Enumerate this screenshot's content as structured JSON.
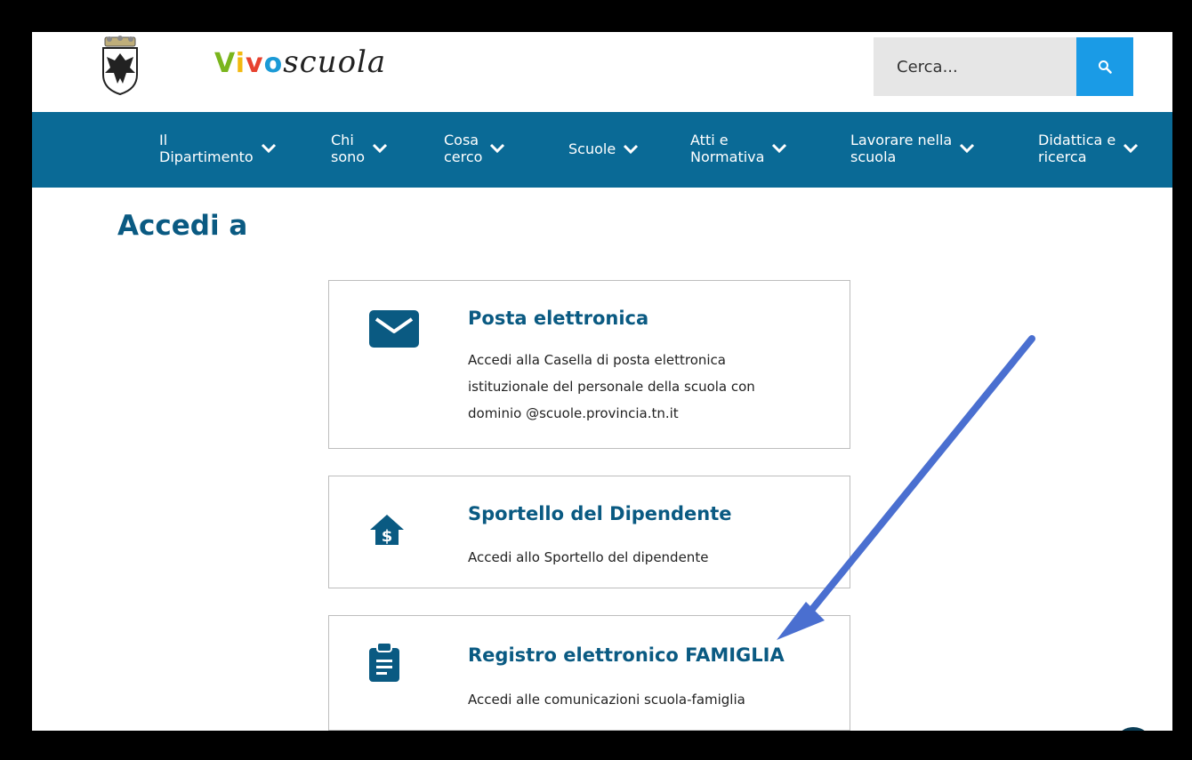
{
  "header": {
    "brand": {
      "v": "V",
      "i": "i",
      "v2": "v",
      "o": "o",
      "rest": "scuola"
    },
    "search_placeholder": "Cerca..."
  },
  "nav": [
    {
      "label": "Il\nDipartimento"
    },
    {
      "label": "Chi\nsono"
    },
    {
      "label": "Cosa\ncerco"
    },
    {
      "label": "Scuole"
    },
    {
      "label": "Atti e\nNormativa"
    },
    {
      "label": "Lavorare nella\nscuola"
    },
    {
      "label": "Didattica e\nricerca"
    }
  ],
  "page": {
    "title": "Accedi a"
  },
  "cards": [
    {
      "title": "Posta elettronica",
      "description": "Accedi alla Casella di posta elettronica istituzionale del personale della scuola con dominio @scuole.provincia.tn.it",
      "icon": "envelope-icon"
    },
    {
      "title": "Sportello del Dipendente",
      "description": "Accedi allo Sportello del dipendente",
      "icon": "house-dollar-icon"
    },
    {
      "title": "Registro elettronico FAMIGLIA",
      "description": "Accedi alle comunicazioni scuola-famiglia",
      "icon": "clipboard-icon"
    }
  ],
  "colors": {
    "nav_bg": "#0a6a96",
    "title": "#0a5a82",
    "search_btn": "#1a9be6",
    "annotation_arrow": "#4a6fd0"
  }
}
